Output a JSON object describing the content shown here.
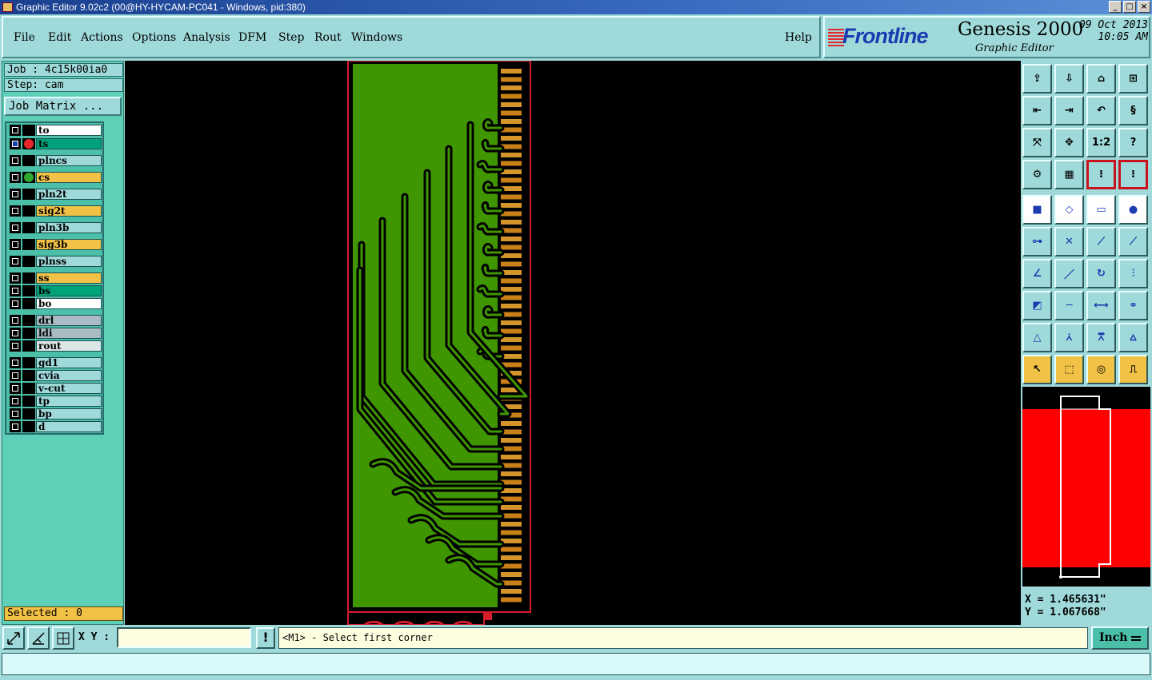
{
  "window": {
    "title": "Graphic Editor 9.02c2 (00@HY-HYCAM-PC041 - Windows, pid:380)"
  },
  "menu": {
    "items": [
      "File",
      "Edit",
      "Actions",
      "Options",
      "Analysis",
      "DFM",
      "Step",
      "Rout",
      "Windows"
    ],
    "help": "Help"
  },
  "brand": {
    "logo": "Frontline",
    "product": "Genesis 2000",
    "subtitle": "Graphic Editor",
    "date": "09 Oct 2013",
    "time": "10:05 AM"
  },
  "job": {
    "job_line": "Job : 4c15k00ia0",
    "step_line": "Step: cam",
    "matrix_button": "Job Matrix ..."
  },
  "layers": [
    {
      "name": "to",
      "color": "#ffffff",
      "marker": "",
      "active": false
    },
    {
      "name": "ts",
      "color": "#00a27a",
      "marker": "#e8262b",
      "active": true
    },
    {
      "name": "plncs",
      "color": "#9fd9d9",
      "marker": "",
      "active": false
    },
    {
      "name": "cs",
      "color": "#f2c247",
      "marker": "#2ea82e",
      "active": false
    },
    {
      "name": "pln2t",
      "color": "#9fd9d9",
      "marker": "",
      "active": false
    },
    {
      "name": "sig2t",
      "color": "#f2c247",
      "marker": "",
      "active": false
    },
    {
      "name": "pln3b",
      "color": "#9fd9d9",
      "marker": "",
      "active": false
    },
    {
      "name": "sig3b",
      "color": "#f2c247",
      "marker": "",
      "active": false
    },
    {
      "name": "plnss",
      "color": "#9fd9d9",
      "marker": "",
      "active": false
    },
    {
      "name": "ss",
      "color": "#f2c247",
      "marker": "",
      "active": false
    },
    {
      "name": "bs",
      "color": "#00a27a",
      "marker": "",
      "active": false
    },
    {
      "name": "bo",
      "color": "#ffffff",
      "marker": "",
      "active": false
    },
    {
      "name": "drl",
      "color": "#a9bcc4",
      "marker": "",
      "active": false
    },
    {
      "name": "ldi",
      "color": "#a9bcc4",
      "marker": "",
      "active": false
    },
    {
      "name": "rout",
      "color": "#dde6e6",
      "marker": "",
      "active": false
    },
    {
      "name": "gd1",
      "color": "#9fd9d9",
      "marker": "",
      "active": false
    },
    {
      "name": "cvia",
      "color": "#9fd9d9",
      "marker": "",
      "active": false
    },
    {
      "name": "v-cut",
      "color": "#9fd9d9",
      "marker": "",
      "active": false
    },
    {
      "name": "tp",
      "color": "#9fd9d9",
      "marker": "",
      "active": false
    },
    {
      "name": "bp",
      "color": "#9fd9d9",
      "marker": "",
      "active": false
    },
    {
      "name": "d",
      "color": "#9fd9d9",
      "marker": "",
      "active": false
    }
  ],
  "selection": {
    "text": "Selected : 0"
  },
  "toolbar": {
    "zoom_ratio_label": "1:2",
    "help_label": "?"
  },
  "cursor": {
    "x_text": "X = 1.465631\"",
    "y_text": "Y = 1.067668\""
  },
  "bottom": {
    "xy_label": "X Y :",
    "xy_value": "",
    "excl": "!",
    "prompt": "<M1> - Select first corner",
    "units": "Inch"
  },
  "status": {
    "text": ""
  },
  "colors": {
    "board": "#3f9600",
    "pads": "#d48a1f",
    "outline": "#d41c2b",
    "panel": "#9fd9d9",
    "highlight": "#f2c247"
  }
}
